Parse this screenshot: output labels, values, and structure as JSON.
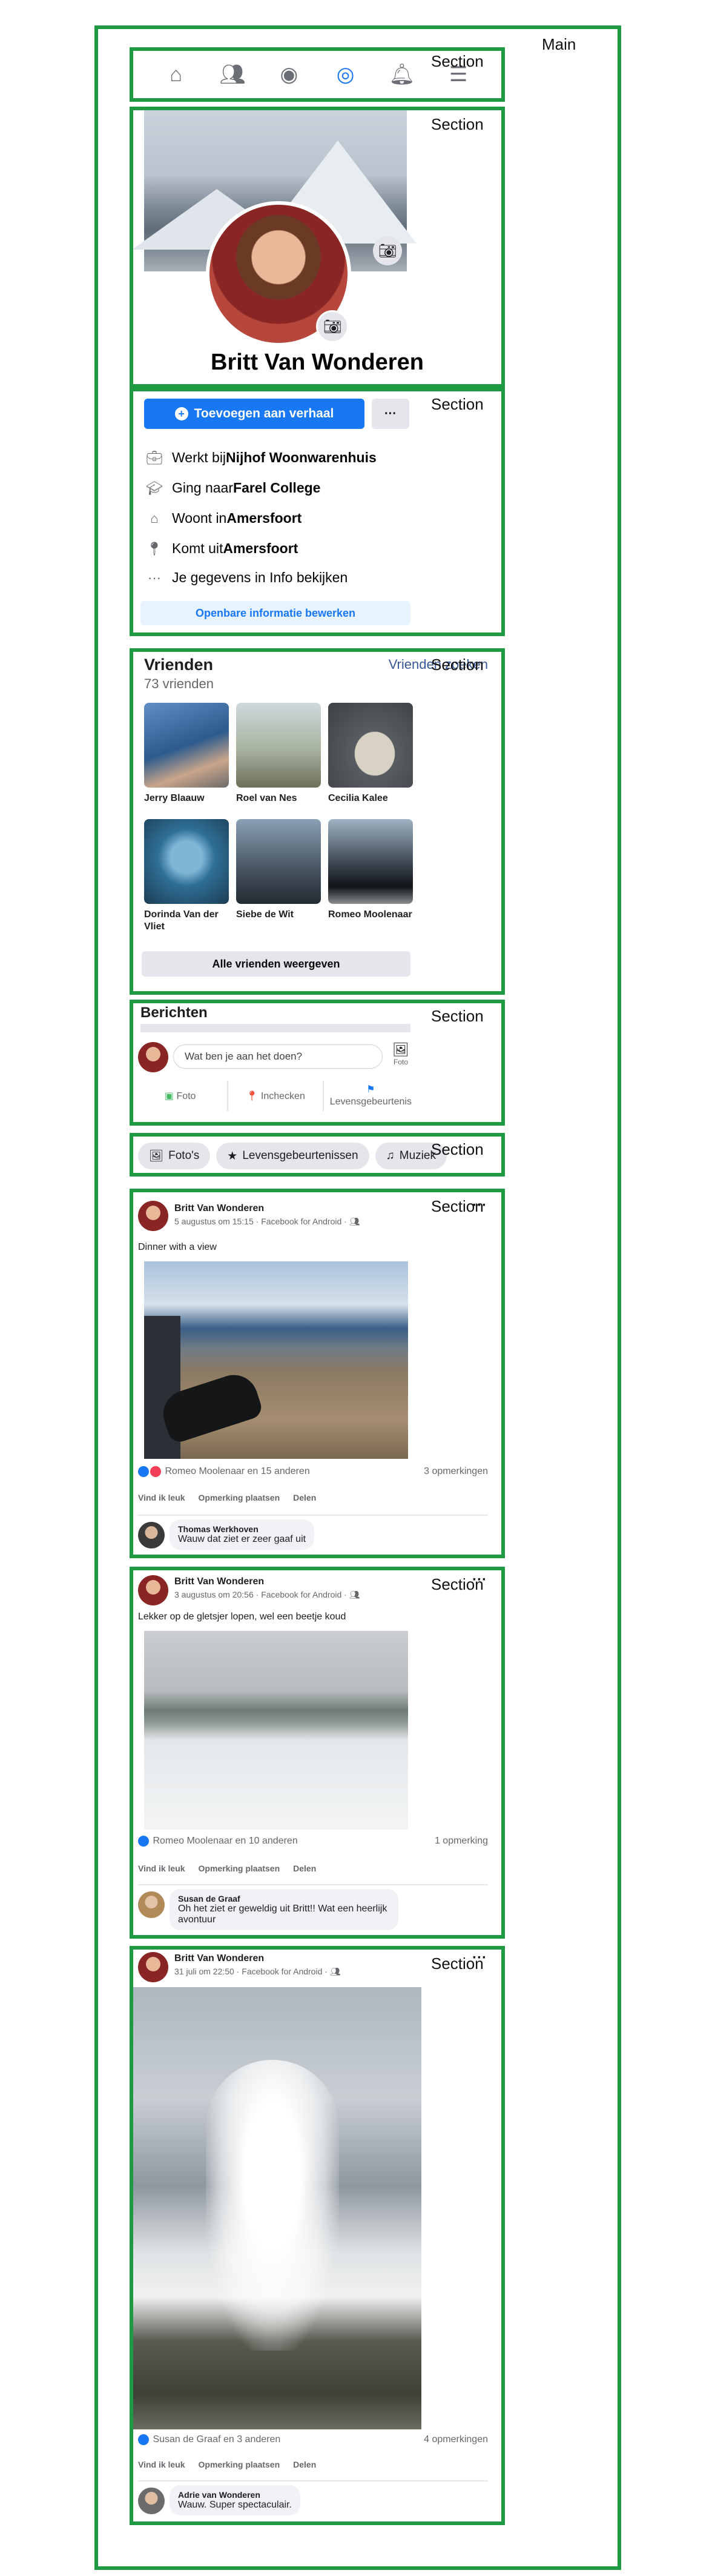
{
  "annotations": {
    "main": "Main",
    "section": "Section"
  },
  "nav": {
    "icons": [
      "home-icon",
      "friends-icon",
      "groups-icon",
      "profile-icon",
      "bell-icon",
      "menu-icon"
    ]
  },
  "profile": {
    "name": "Britt Van Wonderen"
  },
  "intro": {
    "add_story": "Toevoegen aan verhaal",
    "more": "···",
    "work": {
      "prefix": "Werkt bij ",
      "value": "Nijhof Woonwarenhuis"
    },
    "school": {
      "prefix": "Ging naar ",
      "value": "Farel College"
    },
    "lives": {
      "prefix": "Woont in ",
      "value": "Amersfoort"
    },
    "from": {
      "prefix": "Komt uit ",
      "value": "Amersfoort"
    },
    "info": "Je gegevens in Info bekijken",
    "edit_public": "Openbare informatie bewerken"
  },
  "friends": {
    "title": "Vrienden",
    "count": "73 vrienden",
    "find": "Vrienden zoeken",
    "list": [
      {
        "name": "Jerry Blaauw"
      },
      {
        "name": "Roel van Nes"
      },
      {
        "name": "Cecilia Kalee"
      },
      {
        "name": "Dorinda Van der Vliet"
      },
      {
        "name": "Siebe de Wit"
      },
      {
        "name": "Romeo Moolenaar"
      }
    ],
    "show_all": "Alle vrienden weergeven"
  },
  "composer": {
    "title": "Berichten",
    "placeholder": "Wat ben je aan het doen?",
    "photo_side": "Foto",
    "photo": "Foto",
    "checkin": "Inchecken",
    "life_event": "Levensgebeurtenis"
  },
  "filters": [
    "Foto's",
    "Levensgebeurtenissen",
    "Muziek"
  ],
  "posts": [
    {
      "author": "Britt Van Wonderen",
      "meta": "5 augustus om 15:15 · Facebook for Android · ",
      "text": "Dinner with a view",
      "reactions": "Romeo Moolenaar en 15 anderen",
      "comments_count": "3 opmerkingen",
      "actions": [
        "Vind ik leuk",
        "Opmerking plaatsen",
        "Delen"
      ],
      "comment": {
        "name": "Thomas Werkhoven",
        "text": "Wauw dat ziet er zeer gaaf uit"
      }
    },
    {
      "author": "Britt Van Wonderen",
      "meta": "3 augustus om 20:56 · Facebook for Android · ",
      "text": "Lekker op de gletsjer lopen, wel een beetje koud",
      "reactions": "Romeo Moolenaar en 10 anderen",
      "comments_count": "1 opmerking",
      "actions": [
        "Vind ik leuk",
        "Opmerking plaatsen",
        "Delen"
      ],
      "comment": {
        "name": "Susan de Graaf",
        "text": "Oh het ziet er geweldig uit Britt!! Wat een heerlijk avontuur"
      }
    },
    {
      "author": "Britt Van Wonderen",
      "meta": "31 juli om 22:50 · Facebook for Android · ",
      "text": "",
      "reactions": "Susan de Graaf en 3 anderen",
      "comments_count": "4 opmerkingen",
      "actions": [
        "Vind ik leuk",
        "Opmerking plaatsen",
        "Delen"
      ],
      "comment": {
        "name": "Adrie van Wonderen",
        "text": "Wauw. Super spectaculair."
      }
    }
  ]
}
